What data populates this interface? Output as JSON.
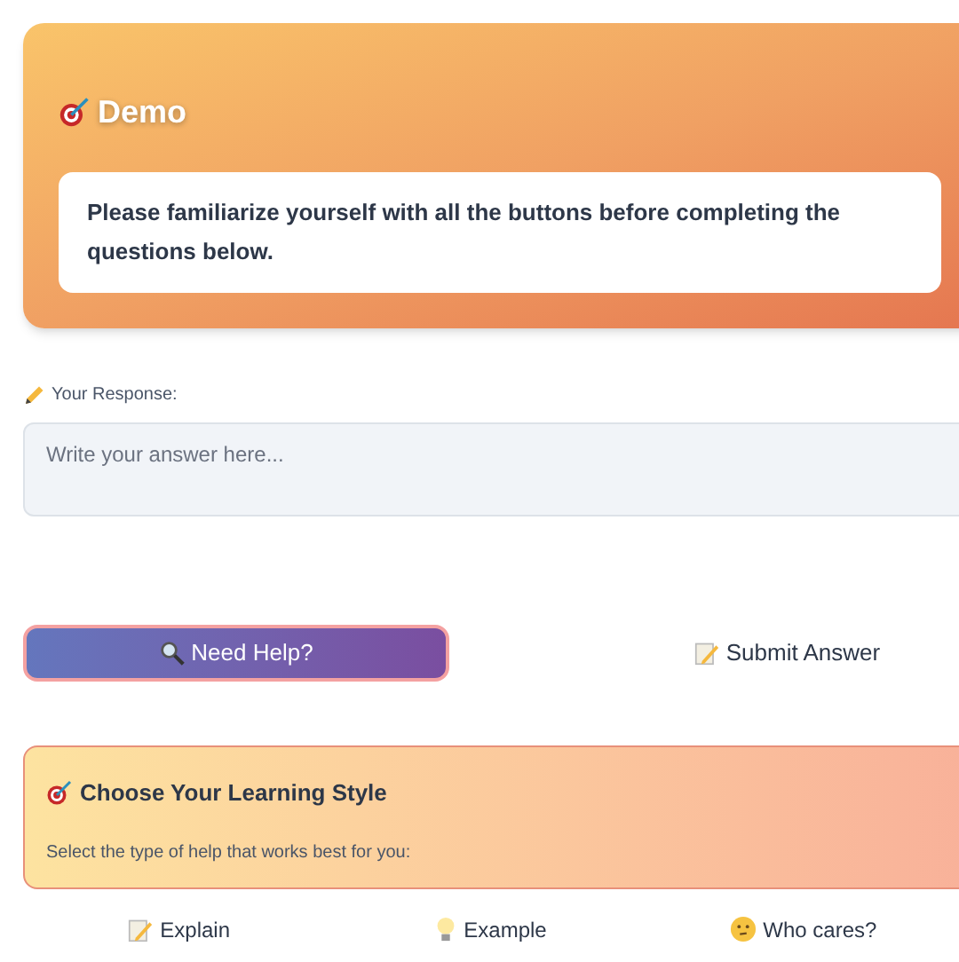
{
  "header": {
    "title": "Demo",
    "notice": "Please familiarize yourself with all the buttons before completing the questions below."
  },
  "response": {
    "label": "Your Response:",
    "placeholder": "Write your answer here..."
  },
  "actions": [
    {
      "label": "Need Help?",
      "kind": "primary"
    },
    {
      "label": "Submit Answer",
      "kind": "plain"
    }
  ],
  "learning_style": {
    "title": "Choose Your Learning Style",
    "subtitle": "Select the type of help that works best for you:"
  },
  "options": [
    {
      "label": "Explain"
    },
    {
      "label": "Example"
    },
    {
      "label": "Who cares?"
    }
  ]
}
